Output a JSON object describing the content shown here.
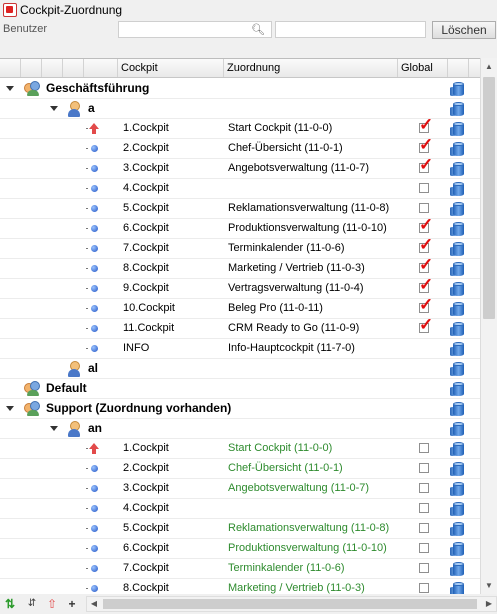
{
  "window": {
    "title": "Cockpit-Zuordnung"
  },
  "filter": {
    "label": "Benutzer",
    "search_value": "",
    "search_icon": "magnifier-icon",
    "clear_button": "Löschen"
  },
  "columns": {
    "cockpit": "Cockpit",
    "zuordnung": "Zuordnung",
    "global": "Global"
  },
  "rows": [
    {
      "kind": "group",
      "label": "Geschäftsführung",
      "expanded": true
    },
    {
      "kind": "user",
      "label": "a",
      "expanded": true
    },
    {
      "kind": "item",
      "marker": "up-arrow",
      "cockpit": "1.Cockpit",
      "zuordnung": "Start Cockpit (11-0-0)",
      "global": true,
      "green": false
    },
    {
      "kind": "item",
      "marker": "dot",
      "cockpit": "2.Cockpit",
      "zuordnung": "Chef-Übersicht (11-0-1)",
      "global": true,
      "green": false
    },
    {
      "kind": "item",
      "marker": "dot",
      "cockpit": "3.Cockpit",
      "zuordnung": "Angebotsverwaltung (11-0-7)",
      "global": true,
      "green": false
    },
    {
      "kind": "item",
      "marker": "dot",
      "cockpit": "4.Cockpit",
      "zuordnung": "",
      "global": false,
      "green": false
    },
    {
      "kind": "item",
      "marker": "dot",
      "cockpit": "5.Cockpit",
      "zuordnung": "Reklamationsverwaltung (11-0-8)",
      "global": false,
      "green": false
    },
    {
      "kind": "item",
      "marker": "dot",
      "cockpit": "6.Cockpit",
      "zuordnung": "Produktionsverwaltung (11-0-10)",
      "global": true,
      "green": false
    },
    {
      "kind": "item",
      "marker": "dot",
      "cockpit": "7.Cockpit",
      "zuordnung": "Terminkalender (11-0-6)",
      "global": true,
      "green": false
    },
    {
      "kind": "item",
      "marker": "dot",
      "cockpit": "8.Cockpit",
      "zuordnung": "Marketing / Vertrieb (11-0-3)",
      "global": true,
      "green": false
    },
    {
      "kind": "item",
      "marker": "dot",
      "cockpit": "9.Cockpit",
      "zuordnung": "Vertragsverwaltung (11-0-4)",
      "global": true,
      "green": false
    },
    {
      "kind": "item",
      "marker": "dot",
      "cockpit": "10.Cockpit",
      "zuordnung": "Beleg Pro (11-0-11)",
      "global": true,
      "green": false
    },
    {
      "kind": "item",
      "marker": "dot",
      "cockpit": "11.Cockpit",
      "zuordnung": "CRM Ready to Go (11-0-9)",
      "global": true,
      "green": false
    },
    {
      "kind": "item",
      "marker": "dot",
      "cockpit": "INFO",
      "zuordnung": "Info-Hauptcockpit (11-7-0)",
      "global": null,
      "green": false
    },
    {
      "kind": "user",
      "label": "al",
      "expanded": false
    },
    {
      "kind": "group",
      "label": "Default",
      "expanded": false
    },
    {
      "kind": "group",
      "label": "Support (Zuordnung vorhanden)",
      "expanded": true
    },
    {
      "kind": "user",
      "label": "an",
      "expanded": true
    },
    {
      "kind": "item",
      "marker": "up-arrow",
      "cockpit": "1.Cockpit",
      "zuordnung": "Start Cockpit (11-0-0)",
      "global": false,
      "green": true
    },
    {
      "kind": "item",
      "marker": "dot",
      "cockpit": "2.Cockpit",
      "zuordnung": "Chef-Übersicht (11-0-1)",
      "global": false,
      "green": true
    },
    {
      "kind": "item",
      "marker": "dot",
      "cockpit": "3.Cockpit",
      "zuordnung": "Angebotsverwaltung (11-0-7)",
      "global": false,
      "green": true
    },
    {
      "kind": "item",
      "marker": "dot",
      "cockpit": "4.Cockpit",
      "zuordnung": "",
      "global": false,
      "green": true
    },
    {
      "kind": "item",
      "marker": "dot",
      "cockpit": "5.Cockpit",
      "zuordnung": "Reklamationsverwaltung (11-0-8)",
      "global": false,
      "green": true
    },
    {
      "kind": "item",
      "marker": "dot",
      "cockpit": "6.Cockpit",
      "zuordnung": "Produktionsverwaltung (11-0-10)",
      "global": false,
      "green": true
    },
    {
      "kind": "item",
      "marker": "dot",
      "cockpit": "7.Cockpit",
      "zuordnung": "Terminkalender (11-0-6)",
      "global": false,
      "green": true
    },
    {
      "kind": "item",
      "marker": "dot",
      "cockpit": "8.Cockpit",
      "zuordnung": "Marketing / Vertrieb (11-0-3)",
      "global": false,
      "green": true
    }
  ],
  "colors": {
    "green_text": "#2e8b2e",
    "check_red": "#e01010",
    "accent_blue": "#1f52c4"
  },
  "bottom_icons": [
    "refresh-users-icon",
    "sort-icon",
    "up-arrow-icon",
    "plus-icon"
  ]
}
